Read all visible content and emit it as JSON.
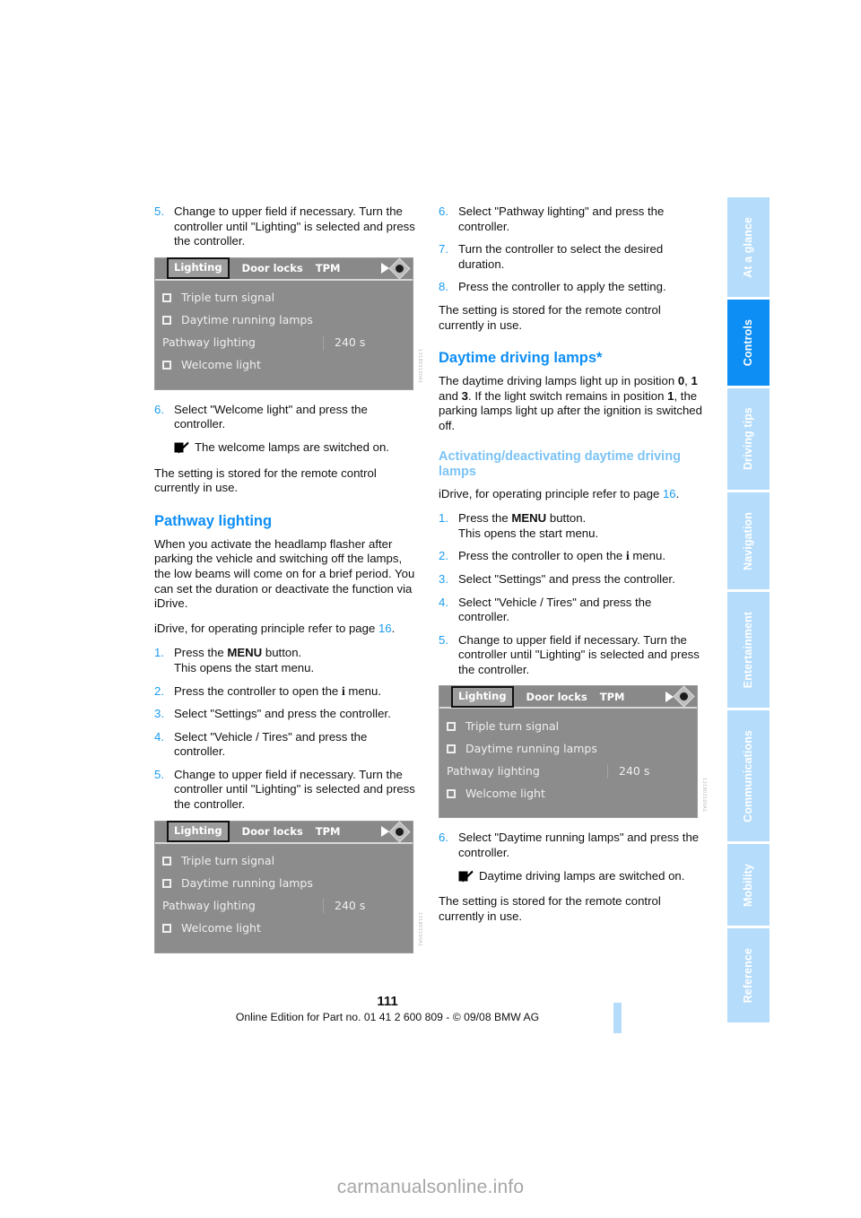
{
  "sidebar": {
    "tabs": [
      {
        "label": "At a glance",
        "active": false
      },
      {
        "label": "Controls",
        "active": true
      },
      {
        "label": "Driving tips",
        "active": false
      },
      {
        "label": "Navigation",
        "active": false
      },
      {
        "label": "Entertainment",
        "active": false
      },
      {
        "label": "Communications",
        "active": false
      },
      {
        "label": "Mobility",
        "active": false
      },
      {
        "label": "Reference",
        "active": false
      }
    ],
    "active_color": "#0d8ef5",
    "inactive_color": "#b5dcfb"
  },
  "left_column": {
    "step5_num": "5.",
    "step5_text": "Change to upper field if necessary. Turn the controller until \"Lighting\" is selected and press the controller.",
    "step6_num": "6.",
    "step6_text": "Select \"Welcome light\" and press the controller.",
    "result_text": "The welcome lamps are switched on.",
    "stored_text": "The setting is stored for the remote control currently in use.",
    "heading_pathway": "Pathway lighting",
    "pathway_body": "When you activate the headlamp flasher after parking the vehicle and switching off the lamps, the low beams will come on for a brief period. You can set the duration or deactivate the function via iDrive.",
    "idrive_ref_pre": "iDrive, for operating principle refer to page ",
    "idrive_ref_page": "16",
    "idrive_ref_post": ".",
    "s1_num": "1.",
    "s1_pre": "Press the ",
    "s1_bold": "MENU",
    "s1_post": " button.",
    "s1_sub": "This opens the start menu.",
    "s2_num": "2.",
    "s2_pre": "Press the controller to open the ",
    "s2_icon": "i",
    "s2_post": " menu.",
    "s3_num": "3.",
    "s3_text": "Select \"Settings\" and press the controller.",
    "s4_num": "4.",
    "s4_text": "Select \"Vehicle / Tires\" and press the controller.",
    "s5_num": "5.",
    "s5_text": "Change to upper field if necessary. Turn the controller until \"Lighting\" is selected and press the controller."
  },
  "right_column": {
    "step6_num": "6.",
    "step6_text": "Select \"Pathway lighting\" and press the controller.",
    "step7_num": "7.",
    "step7_text": "Turn the controller to select the desired duration.",
    "step8_num": "8.",
    "step8_text": "Press the controller to apply the setting.",
    "stored_text": "The setting is stored for the remote control currently in use.",
    "heading_daytime": "Daytime driving lamps*",
    "daytime_body_1": "The daytime driving lamps light up in position ",
    "daytime_pos_0": "0",
    "daytime_body_2": ", ",
    "daytime_pos_1": "1",
    "daytime_body_3": " and ",
    "daytime_pos_3": "3",
    "daytime_body_4": ". If the light switch remains in position ",
    "daytime_pos_1b": "1",
    "daytime_body_5": ", the parking lamps light up after the ignition is switched off.",
    "subheading_activating": "Activating/deactivating daytime driving lamps",
    "idrive_ref_pre": "iDrive, for operating principle refer to page ",
    "idrive_ref_page": "16",
    "idrive_ref_post": ".",
    "s1_num": "1.",
    "s1_pre": "Press the ",
    "s1_bold": "MENU",
    "s1_post": " button.",
    "s1_sub": "This opens the start menu.",
    "s2_num": "2.",
    "s2_pre": "Press the controller to open the ",
    "s2_icon": "i",
    "s2_post": " menu.",
    "s3_num": "3.",
    "s3_text": "Select \"Settings\" and press the controller.",
    "s4_num": "4.",
    "s4_text": "Select \"Vehicle / Tires\" and press the controller.",
    "s5_num": "5.",
    "s5_text": "Change to upper field if necessary. Turn the controller until \"Lighting\" is selected and press the controller.",
    "s6_num": "6.",
    "s6_text": "Select \"Daytime running lamps\" and press the controller.",
    "result_text": "Daytime driving lamps are switched on.",
    "stored_text_2": "The setting is stored for the remote control currently in use."
  },
  "idrive_screen": {
    "tab_selected": "Lighting",
    "tab_2": "Door locks",
    "tab_3": "TPM",
    "rows": [
      {
        "label": "Triple turn signal",
        "checkbox": true,
        "value": ""
      },
      {
        "label": "Daytime running lamps",
        "checkbox": true,
        "value": ""
      },
      {
        "label": "Pathway lighting",
        "checkbox": false,
        "value": "240 s"
      },
      {
        "label": "Welcome light",
        "checkbox": true,
        "value": ""
      }
    ],
    "image_code": "131803100A1"
  },
  "footer": {
    "page_number": "111",
    "edition": "Online Edition for Part no. 01 41 2 600 809 - © 09/08 BMW AG"
  },
  "watermark": "carmanualsonline.info"
}
